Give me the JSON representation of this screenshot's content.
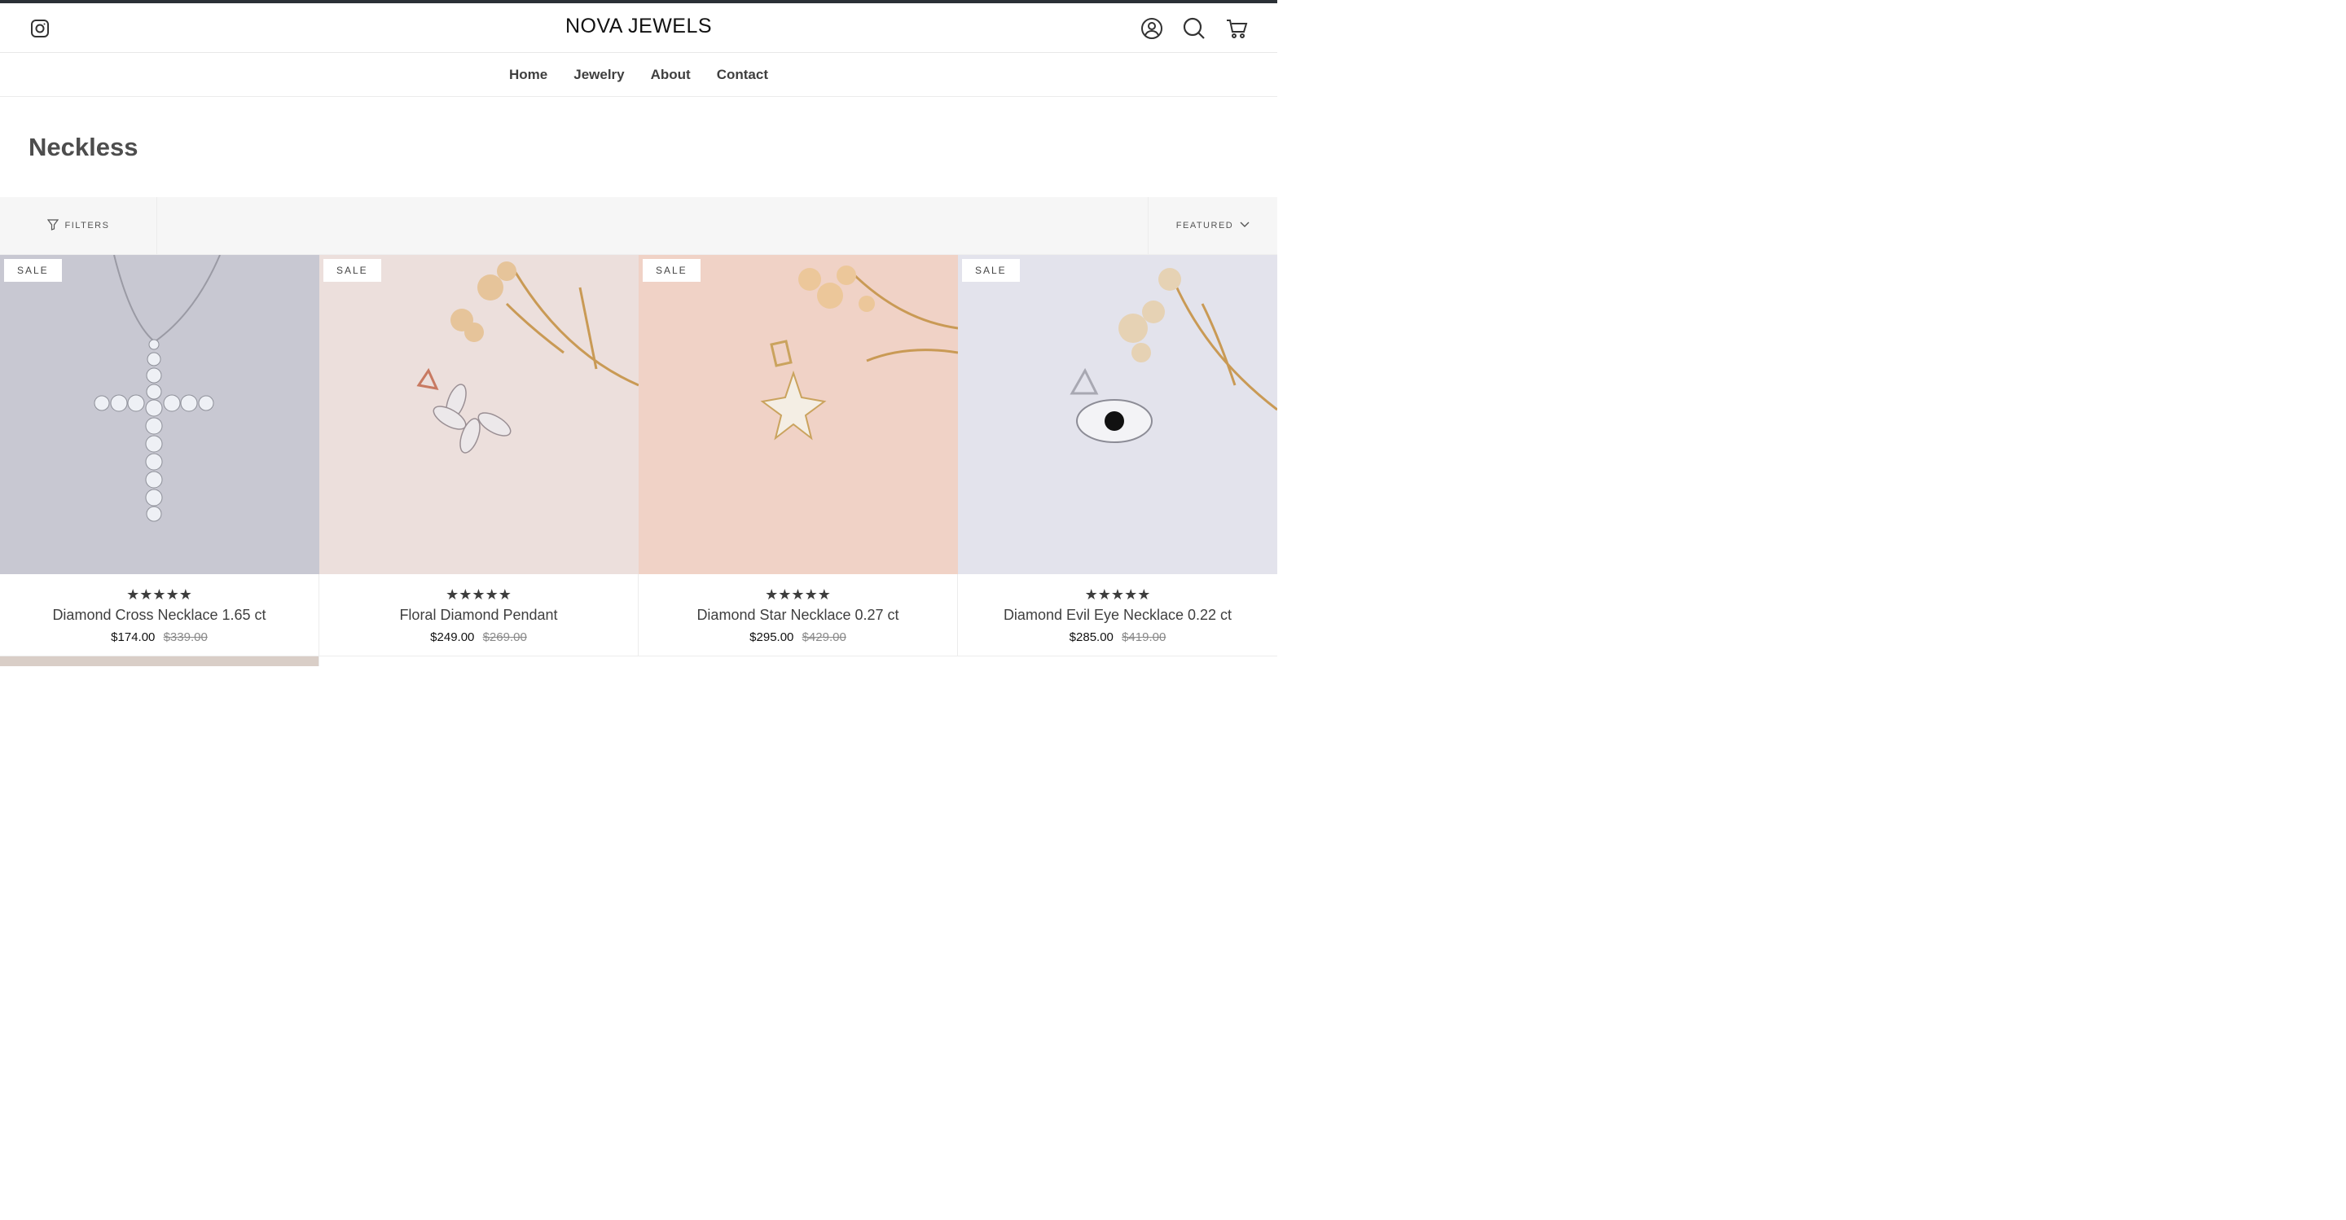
{
  "header": {
    "logo": "NOVA JEWELS"
  },
  "nav": {
    "items": [
      "Home",
      "Jewelry",
      "About",
      "Contact"
    ]
  },
  "page": {
    "title": "Neckless"
  },
  "toolbar": {
    "filters_label": "FILTERS",
    "sort_label": "FEATURED"
  },
  "products": [
    {
      "badge": "SALE",
      "stars": "★★★★★",
      "title": "Diamond Cross Necklace 1.65 ct",
      "price": "$174.00",
      "compare": "$339.00"
    },
    {
      "badge": "SALE",
      "stars": "★★★★★",
      "title": "Floral Diamond Pendant",
      "price": "$249.00",
      "compare": "$269.00"
    },
    {
      "badge": "SALE",
      "stars": "★★★★★",
      "title": "Diamond Star Necklace 0.27 ct",
      "price": "$295.00",
      "compare": "$429.00"
    },
    {
      "badge": "SALE",
      "stars": "★★★★★",
      "title": "Diamond Evil Eye Necklace 0.22 ct",
      "price": "$285.00",
      "compare": "$419.00"
    }
  ],
  "icons": {
    "instagram": "instagram-icon",
    "account": "account-icon",
    "search": "search-icon",
    "cart": "cart-icon",
    "filter": "filter-icon",
    "sort_chevron": "chevron-down-icon"
  },
  "colors": {
    "top_strip": "#2b3136",
    "toolbar_bg": "#f6f6f6",
    "title_text": "#4d4d4d"
  }
}
